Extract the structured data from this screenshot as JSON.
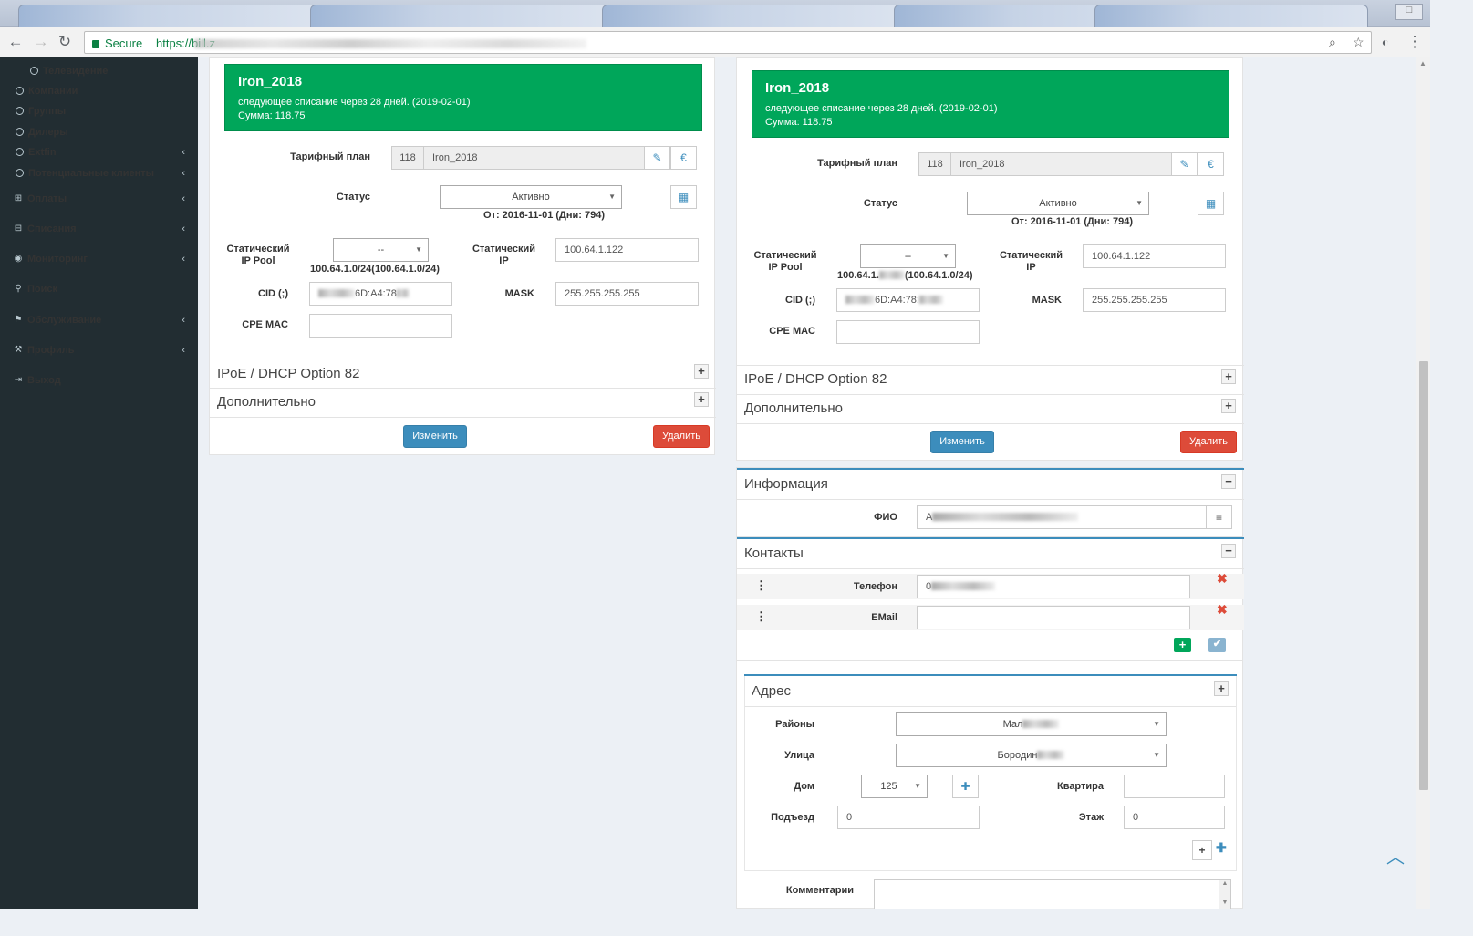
{
  "browser": {
    "secure_label": "Secure",
    "url_visible": "https://bill.z"
  },
  "sidebar": {
    "items": [
      {
        "label": "Телевидение",
        "icon": "circle-icon"
      },
      {
        "label": "Компании",
        "icon": "circle-icon"
      },
      {
        "label": "Группы",
        "icon": "circle-icon"
      },
      {
        "label": "Дилеры",
        "icon": "circle-icon"
      },
      {
        "label": "Extfin",
        "icon": "circle-icon"
      },
      {
        "label": "Потенциальные клиенты",
        "icon": "circle-icon"
      },
      {
        "label": "Оплаты",
        "icon": "money-icon"
      },
      {
        "label": "Списания",
        "icon": "minus-square-icon"
      },
      {
        "label": "Мониторинг",
        "icon": "eye-icon"
      },
      {
        "label": "Поиск",
        "icon": "search-icon"
      },
      {
        "label": "Обслуживание",
        "icon": "flag-icon"
      },
      {
        "label": "Профиль",
        "icon": "wrench-icon"
      },
      {
        "label": "Выход",
        "icon": "sign-out-icon"
      }
    ]
  },
  "left": {
    "tariff_name": "Iron_2018",
    "next_charge": "следующее списание через 28 дней. (2019-02-01)",
    "sum": "Сумма: 118.75",
    "tariff_label": "Тарифный план",
    "tariff_id": "118",
    "tariff_value": "Iron_2018",
    "status_label": "Статус",
    "status_value": "Активно",
    "status_since": "От: 2016-11-01 (Дни: 794)",
    "pool_label1": "Статический",
    "pool_label2": "IP Pool",
    "pool_value": "--",
    "pool_sub": "100.64.1.0/24(100.64.1.0/24)",
    "ip_label1": "Статический",
    "ip_label2": "IP",
    "ip_value": "100.64.1.122",
    "cid_label": "CID (;)",
    "cid_value": "6D:A4:78",
    "mask_label": "MASK",
    "mask_value": "255.255.255.255",
    "cpe_label": "CPE MAC",
    "ipoe_label": "IPoE / DHCP Option 82",
    "extra_label": "Дополнительно",
    "change_btn": "Изменить",
    "delete_btn": "Удалить"
  },
  "right": {
    "tariff_name": "Iron_2018",
    "next_charge": "следующее списание через 28 дней. (2019-02-01)",
    "sum": "Сумма: 118.75",
    "tariff_label": "Тарифный план",
    "tariff_id": "118",
    "tariff_value": "Iron_2018",
    "status_label": "Статус",
    "status_value": "Активно",
    "status_since": "От: 2016-11-01 (Дни: 794)",
    "pool_label1": "Статический",
    "pool_label2": "IP Pool",
    "pool_value": "--",
    "pool_sub_a": "100.64.1.",
    "pool_sub_b": "(100.64.1.0/24)",
    "ip_label1": "Статический",
    "ip_label2": "IP",
    "ip_value": "100.64.1.122",
    "cid_label": "CID (;)",
    "cid_value": "6D:A4:78:",
    "mask_label": "MASK",
    "mask_value": "255.255.255.255",
    "cpe_label": "CPE MAC",
    "ipoe_label": "IPoE / DHCP Option 82",
    "extra_label": "Дополнительно",
    "change_btn": "Изменить",
    "delete_btn": "Удалить",
    "info_title": "Информация",
    "fio_label": "ФИО",
    "fio_value": "A",
    "contacts_title": "Контакты",
    "phone_label": "Телефон",
    "phone_value": "0",
    "email_label": "EMail",
    "address_title": "Адрес",
    "district_label": "Районы",
    "district_value": "Мал",
    "street_label": "Улица",
    "street_value": "Бородин",
    "house_label": "Дом",
    "house_value": "125",
    "apt_label": "Квартира",
    "entrance_label": "Подъезд",
    "entrance_value": "0",
    "floor_label": "Этаж",
    "floor_value": "0",
    "comments_label": "Комментарии"
  }
}
